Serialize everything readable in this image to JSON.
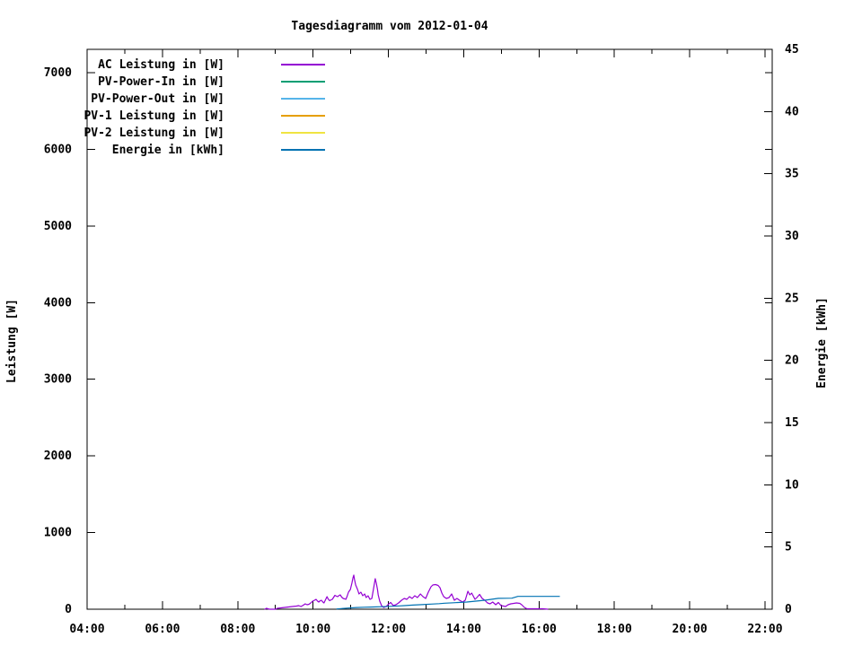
{
  "page": {
    "background": "#ffffff",
    "text_color": "#000000"
  },
  "chart_data": {
    "type": "line",
    "title": "Tagesdiagramm vom 2012-01-04",
    "xlabel": "",
    "ylabel_left": "Leistung [W]",
    "ylabel_right": "Energie [kWh]",
    "grid": false,
    "legend": {
      "position": "top-left-inside",
      "entries": [
        {
          "label": "AC Leistung in [W]",
          "color": "#9400d3"
        },
        {
          "label": "PV-Power-In in [W]",
          "color": "#009e73"
        },
        {
          "label": "PV-Power-Out in [W]",
          "color": "#56b4e9"
        },
        {
          "label": "PV-1 Leistung in [W]",
          "color": "#e69f00"
        },
        {
          "label": "PV-2 Leistung in [W]",
          "color": "#f0e442"
        },
        {
          "label": "Energie in [kWh]",
          "color": "#0072b2"
        }
      ]
    },
    "x_axis": {
      "unit": "time of day (hours)",
      "range": [
        4,
        22.2
      ],
      "ticks": [
        {
          "v": 4,
          "label": "04:00"
        },
        {
          "v": 6,
          "label": "06:00"
        },
        {
          "v": 8,
          "label": "08:00"
        },
        {
          "v": 10,
          "label": "10:00"
        },
        {
          "v": 12,
          "label": "12:00"
        },
        {
          "v": 14,
          "label": "14:00"
        },
        {
          "v": 16,
          "label": "16:00"
        },
        {
          "v": 18,
          "label": "18:00"
        },
        {
          "v": 20,
          "label": "20:00"
        },
        {
          "v": 22,
          "label": "22:00"
        }
      ],
      "minor_tick_values": [
        5,
        7,
        9,
        11,
        13,
        15,
        17,
        19,
        21
      ]
    },
    "y1_axis": {
      "label": "Leistung [W]",
      "range": [
        0,
        7300
      ],
      "ticks": [
        {
          "v": 0,
          "label": "0"
        },
        {
          "v": 1000,
          "label": "1000"
        },
        {
          "v": 2000,
          "label": "2000"
        },
        {
          "v": 3000,
          "label": "3000"
        },
        {
          "v": 4000,
          "label": "4000"
        },
        {
          "v": 5000,
          "label": "5000"
        },
        {
          "v": 6000,
          "label": "6000"
        },
        {
          "v": 7000,
          "label": "7000"
        }
      ]
    },
    "y2_axis": {
      "label": "Energie [kWh]",
      "range": [
        0,
        45
      ],
      "ticks": [
        {
          "v": 0,
          "label": "0"
        },
        {
          "v": 5,
          "label": "5"
        },
        {
          "v": 10,
          "label": "10"
        },
        {
          "v": 15,
          "label": "15"
        },
        {
          "v": 20,
          "label": "20"
        },
        {
          "v": 25,
          "label": "25"
        },
        {
          "v": 30,
          "label": "30"
        },
        {
          "v": 35,
          "label": "35"
        },
        {
          "v": 40,
          "label": "40"
        },
        {
          "v": 45,
          "label": "45"
        }
      ]
    },
    "series": [
      {
        "name": "AC Leistung in [W]",
        "color": "#9400d3",
        "axis": "y1",
        "unit": "W",
        "points": [
          [
            8.72,
            0
          ],
          [
            8.76,
            12
          ],
          [
            8.8,
            6
          ],
          [
            8.84,
            0
          ],
          [
            9.0,
            0
          ],
          [
            9.05,
            12
          ],
          [
            9.15,
            18
          ],
          [
            9.25,
            23
          ],
          [
            9.35,
            29
          ],
          [
            9.45,
            35
          ],
          [
            9.56,
            41
          ],
          [
            9.62,
            47
          ],
          [
            9.68,
            35
          ],
          [
            9.74,
            53
          ],
          [
            9.79,
            70
          ],
          [
            9.84,
            58
          ],
          [
            9.89,
            64
          ],
          [
            9.94,
            82
          ],
          [
            9.99,
            105
          ],
          [
            10.04,
            117
          ],
          [
            10.08,
            129
          ],
          [
            10.12,
            105
          ],
          [
            10.15,
            94
          ],
          [
            10.19,
            111
          ],
          [
            10.22,
            117
          ],
          [
            10.26,
            94
          ],
          [
            10.29,
            82
          ],
          [
            10.33,
            123
          ],
          [
            10.37,
            164
          ],
          [
            10.4,
            135
          ],
          [
            10.44,
            111
          ],
          [
            10.48,
            123
          ],
          [
            10.51,
            129
          ],
          [
            10.55,
            158
          ],
          [
            10.58,
            181
          ],
          [
            10.62,
            170
          ],
          [
            10.65,
            164
          ],
          [
            10.68,
            176
          ],
          [
            10.72,
            187
          ],
          [
            10.76,
            158
          ],
          [
            10.8,
            140
          ],
          [
            10.84,
            135
          ],
          [
            10.87,
            129
          ],
          [
            10.91,
            176
          ],
          [
            10.94,
            222
          ],
          [
            10.99,
            258
          ],
          [
            11.03,
            339
          ],
          [
            11.06,
            410
          ],
          [
            11.08,
            445
          ],
          [
            11.1,
            387
          ],
          [
            11.13,
            316
          ],
          [
            11.18,
            258
          ],
          [
            11.22,
            199
          ],
          [
            11.27,
            222
          ],
          [
            11.32,
            176
          ],
          [
            11.37,
            199
          ],
          [
            11.41,
            152
          ],
          [
            11.46,
            176
          ],
          [
            11.51,
            129
          ],
          [
            11.56,
            140
          ],
          [
            11.61,
            281
          ],
          [
            11.65,
            398
          ],
          [
            11.68,
            339
          ],
          [
            11.71,
            258
          ],
          [
            11.73,
            187
          ],
          [
            11.77,
            105
          ],
          [
            11.82,
            47
          ],
          [
            11.87,
            23
          ],
          [
            11.94,
            35
          ],
          [
            12.01,
            70
          ],
          [
            12.06,
            88
          ],
          [
            12.13,
            47
          ],
          [
            12.2,
            58
          ],
          [
            12.27,
            82
          ],
          [
            12.35,
            117
          ],
          [
            12.42,
            140
          ],
          [
            12.49,
            129
          ],
          [
            12.56,
            164
          ],
          [
            12.63,
            140
          ],
          [
            12.7,
            176
          ],
          [
            12.77,
            152
          ],
          [
            12.85,
            199
          ],
          [
            12.92,
            164
          ],
          [
            12.99,
            140
          ],
          [
            13.06,
            222
          ],
          [
            13.13,
            293
          ],
          [
            13.18,
            316
          ],
          [
            13.25,
            322
          ],
          [
            13.32,
            310
          ],
          [
            13.37,
            281
          ],
          [
            13.42,
            211
          ],
          [
            13.47,
            164
          ],
          [
            13.54,
            140
          ],
          [
            13.61,
            152
          ],
          [
            13.68,
            199
          ],
          [
            13.75,
            117
          ],
          [
            13.82,
            140
          ],
          [
            13.89,
            117
          ],
          [
            13.97,
            94
          ],
          [
            14.04,
            117
          ],
          [
            14.11,
            234
          ],
          [
            14.16,
            187
          ],
          [
            14.21,
            211
          ],
          [
            14.25,
            176
          ],
          [
            14.3,
            129
          ],
          [
            14.35,
            152
          ],
          [
            14.42,
            193
          ],
          [
            14.49,
            140
          ],
          [
            14.56,
            117
          ],
          [
            14.63,
            82
          ],
          [
            14.7,
            70
          ],
          [
            14.77,
            94
          ],
          [
            14.85,
            58
          ],
          [
            14.92,
            88
          ],
          [
            14.99,
            47
          ],
          [
            15.06,
            41
          ],
          [
            15.11,
            35
          ],
          [
            15.18,
            58
          ],
          [
            15.25,
            70
          ],
          [
            15.33,
            76
          ],
          [
            15.4,
            82
          ],
          [
            15.49,
            76
          ],
          [
            15.54,
            58
          ],
          [
            15.61,
            23
          ],
          [
            15.68,
            6
          ],
          [
            15.8,
            6
          ],
          [
            15.95,
            6
          ],
          [
            16.1,
            6
          ],
          [
            16.23,
            0
          ]
        ]
      },
      {
        "name": "PV-Power-In in [W]",
        "color": "#009e73",
        "axis": "y1",
        "unit": "W",
        "points": []
      },
      {
        "name": "PV-Power-Out in [W]",
        "color": "#56b4e9",
        "axis": "y1",
        "unit": "W",
        "points": []
      },
      {
        "name": "PV-1 Leistung in [W]",
        "color": "#e69f00",
        "axis": "y1",
        "unit": "W",
        "points": []
      },
      {
        "name": "PV-2 Leistung in [W]",
        "color": "#f0e442",
        "axis": "y1",
        "unit": "W",
        "points": []
      },
      {
        "name": "Energie in [kWh]",
        "color": "#0072b2",
        "axis": "y2",
        "unit": "kWh",
        "points": [
          [
            10.63,
            0.02
          ],
          [
            10.75,
            0.05
          ],
          [
            10.9,
            0.09
          ],
          [
            11.15,
            0.14
          ],
          [
            11.35,
            0.16
          ],
          [
            11.6,
            0.18
          ],
          [
            11.82,
            0.2
          ],
          [
            12.06,
            0.23
          ],
          [
            12.3,
            0.27
          ],
          [
            12.42,
            0.29
          ],
          [
            12.65,
            0.33
          ],
          [
            12.77,
            0.35
          ],
          [
            13.0,
            0.39
          ],
          [
            13.13,
            0.41
          ],
          [
            13.35,
            0.45
          ],
          [
            13.49,
            0.48
          ],
          [
            13.73,
            0.52
          ],
          [
            13.85,
            0.54
          ],
          [
            14.08,
            0.58
          ],
          [
            14.32,
            0.65
          ],
          [
            14.56,
            0.72
          ],
          [
            14.75,
            0.8
          ],
          [
            14.92,
            0.87
          ],
          [
            15.28,
            0.89
          ],
          [
            15.44,
            1.03
          ],
          [
            16.54,
            1.03
          ]
        ]
      }
    ]
  }
}
